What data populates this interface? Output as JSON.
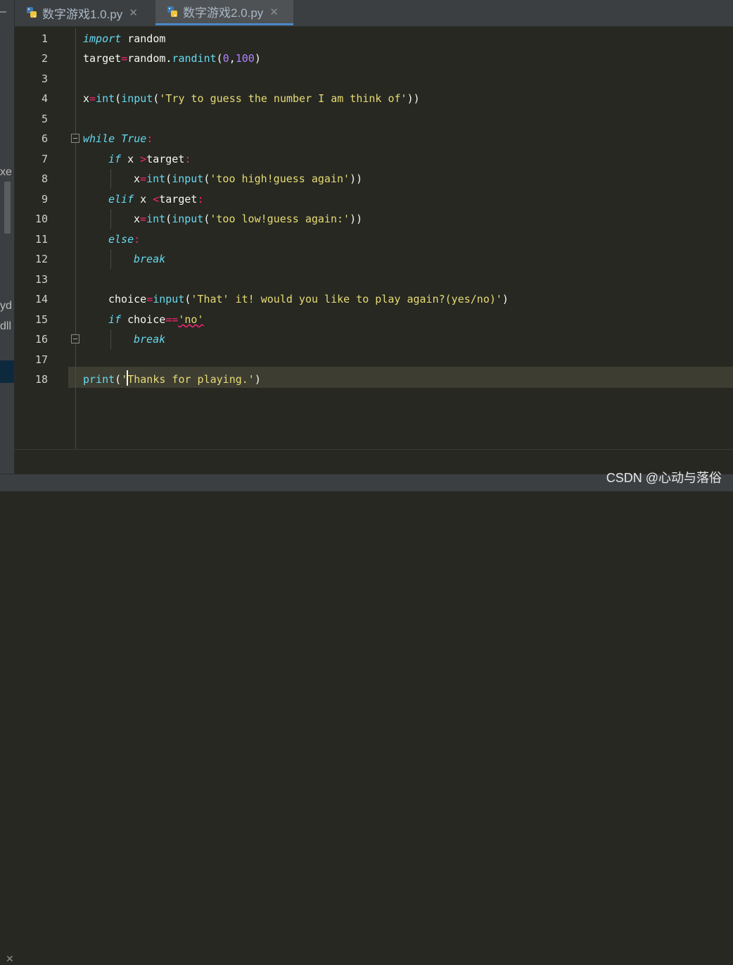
{
  "tabs": [
    {
      "label": "数字游戏1.0.py",
      "active": false
    },
    {
      "label": "数字游戏2.0.py",
      "active": true
    }
  ],
  "close_glyph": "✕",
  "left_panel": {
    "collapse_glyph": "–",
    "fragments": [
      "xe",
      "yd",
      "dll"
    ]
  },
  "line_numbers": [
    "1",
    "2",
    "3",
    "4",
    "5",
    "6",
    "7",
    "8",
    "9",
    "10",
    "11",
    "12",
    "13",
    "14",
    "15",
    "16",
    "17",
    "18"
  ],
  "code": {
    "l1": {
      "kw": "import",
      "rest": " random"
    },
    "l2": {
      "a": "target",
      "op": "=",
      "b": "random.",
      "fn": "randint",
      "p1": "(",
      "n1": "0",
      "c": ",",
      "n2": "100",
      "p2": ")"
    },
    "l4": {
      "a": "x",
      "op": "=",
      "f1": "int",
      "p1": "(",
      "f2": "input",
      "p2": "(",
      "s": "'Try to guess the number I am think of'",
      "p3": "))"
    },
    "l6": {
      "kw": "while",
      "sp": " ",
      "kw2": "True",
      "colon": ":"
    },
    "l7": {
      "kw": "if",
      "a": " x ",
      "op": ">",
      "b": "target",
      "colon": ":"
    },
    "l8": {
      "a": "x",
      "op": "=",
      "f1": "int",
      "p1": "(",
      "f2": "input",
      "p2": "(",
      "s": "'too high!guess again'",
      "p3": "))"
    },
    "l9": {
      "kw": "elif",
      "a": " x ",
      "op": "<",
      "b": "target",
      "colon": ":"
    },
    "l10": {
      "a": "x",
      "op": "=",
      "f1": "int",
      "p1": "(",
      "f2": "input",
      "p2": "(",
      "s": "'too low!guess again:'",
      "p3": "))"
    },
    "l11": {
      "kw": "else",
      "colon": ":"
    },
    "l12": {
      "kw": "break"
    },
    "l14": {
      "a": "choice",
      "op": "=",
      "f1": "input",
      "p1": "(",
      "s": "'That' it! would you like to play again?(yes/no)'",
      "p2": ")"
    },
    "l15": {
      "kw": "if",
      "a": " choice",
      "op": "==",
      "s": "'no'"
    },
    "l16": {
      "kw": "break"
    },
    "l18": {
      "f1": "print",
      "p1": "(",
      "s": "'Thanks for playing.'",
      "p2": ")"
    }
  },
  "watermark": "CSDN @心动与落俗",
  "colors": {
    "background": "#272822",
    "keyword": "#66d9ef",
    "string": "#e6db74",
    "operator": "#f92672",
    "number": "#ae81ff",
    "tab_accent": "#4a88c7"
  }
}
